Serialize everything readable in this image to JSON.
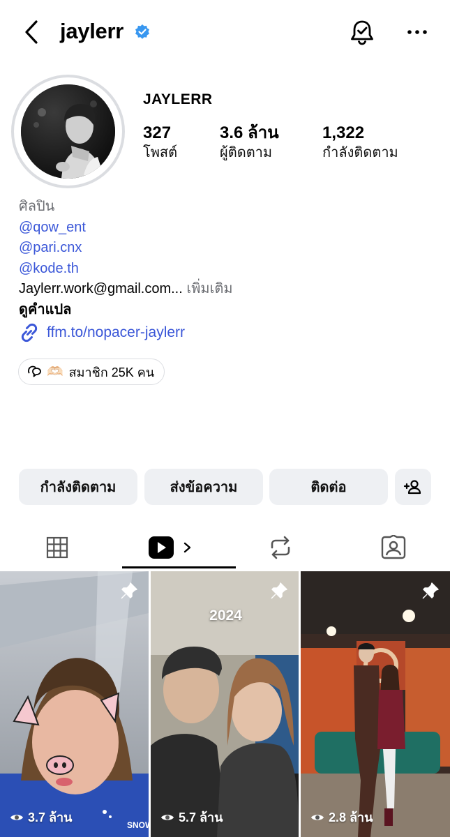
{
  "header": {
    "username": "jaylerr"
  },
  "profile": {
    "display_name": "JAYLERR",
    "stats": [
      {
        "value": "327",
        "label": "โพสต์"
      },
      {
        "value": "3.6 ล้าน",
        "label": "ผู้ติดตาม"
      },
      {
        "value": "1,322",
        "label": "กำลังติดตาม"
      }
    ]
  },
  "bio": {
    "category": "ศิลปิน",
    "mentions": [
      "@qow_ent",
      "@pari.cnx",
      "@kode.th"
    ],
    "email_line": "Jaylerr.work@gmail.com...",
    "more": "เพิ่มเติม",
    "translate": "ดูคำแปล",
    "link": "ffm.to/nopacer-jaylerr"
  },
  "channel": {
    "emoji": "🫶🏻",
    "label": "สมาชิก 25K คน"
  },
  "actions": {
    "following": "กำลังติดตาม",
    "message": "ส่งข้อความ",
    "contact": "ติดต่อ"
  },
  "tabs": [
    "grid-icon",
    "reels-icon",
    "reposts-icon",
    "tagged-icon"
  ],
  "reels": [
    {
      "views": "3.7 ล้าน",
      "pinned": true
    },
    {
      "views": "5.7 ล้าน",
      "pinned": true,
      "overlay_text": "2024"
    },
    {
      "views": "2.8 ล้าน",
      "pinned": true
    }
  ],
  "colors": {
    "link": "#3b57d8",
    "verified": "#3897f0",
    "button_bg": "#eef0f3",
    "muted": "#6c6e73"
  }
}
